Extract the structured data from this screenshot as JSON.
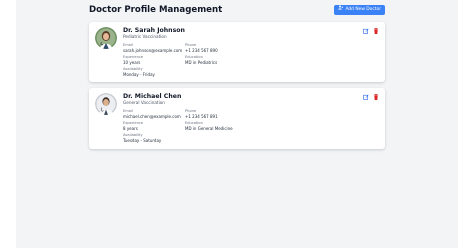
{
  "header": {
    "title": "Doctor Profile Management",
    "add_button_label": "Add New Doctor"
  },
  "labels": {
    "email": "Email",
    "phone": "Phone",
    "experience": "Experience",
    "education": "Education",
    "availability": "Availability"
  },
  "doctors": [
    {
      "name": "Dr. Sarah Johnson",
      "specialty": "Pediatric Vaccination",
      "email": "sarah.johnson@example.com",
      "phone": "+1 234 567 890",
      "experience": "10 years",
      "education": "MD in Pediatrics",
      "availability": "Monday - Friday"
    },
    {
      "name": "Dr. Michael Chen",
      "specialty": "General Vaccination",
      "email": "michael.chen@example.com",
      "phone": "+1 234 567 891",
      "experience": "8 years",
      "education": "MD in General Medicine",
      "availability": "Tuesday - Saturday"
    }
  ],
  "colors": {
    "primary": "#3b82f6",
    "edit": "#2563eb",
    "delete": "#dc2626",
    "background": "#f3f4f6"
  },
  "icons": {
    "add": "user-plus-icon",
    "edit": "edit-icon",
    "delete": "trash-icon"
  }
}
